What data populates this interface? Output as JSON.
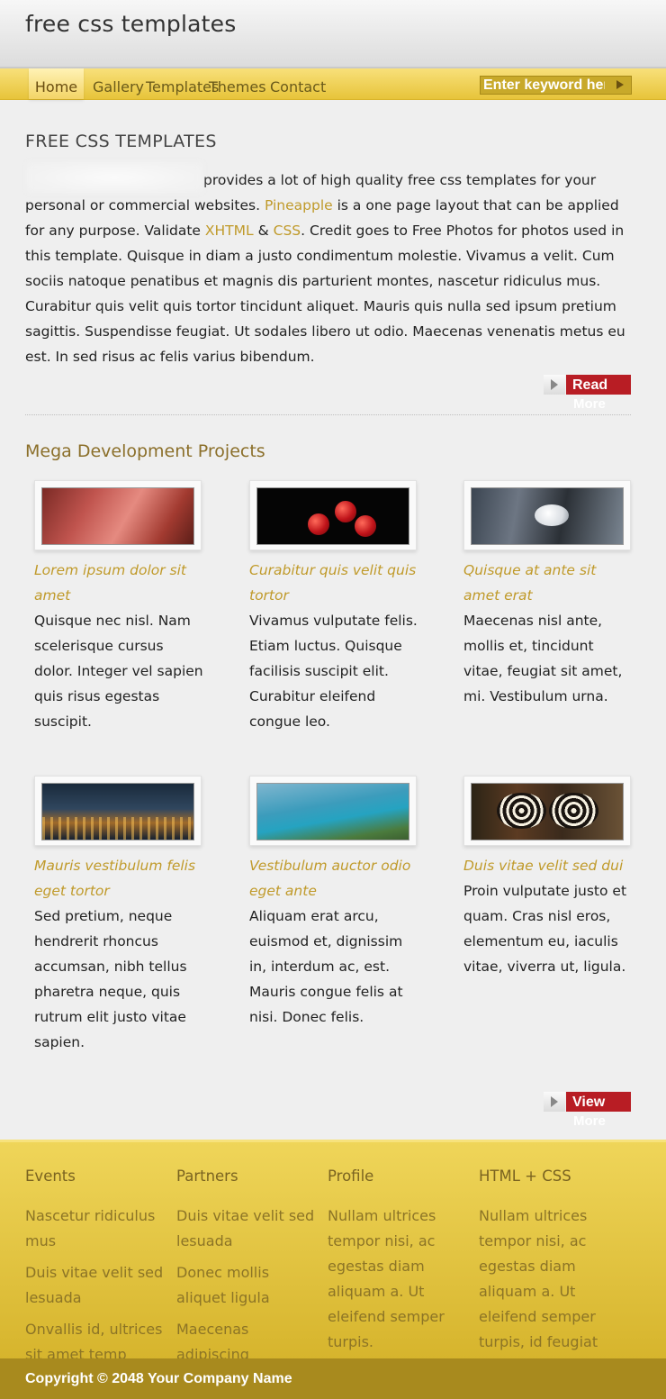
{
  "site": {
    "title": "free css templates"
  },
  "nav": {
    "items": [
      "Home",
      "Gallery",
      "Templates",
      "Themes",
      "Contact"
    ],
    "search_placeholder": "Enter keyword here",
    "accent": "#e9c83e"
  },
  "intro": {
    "title": "FREE CSS TEMPLATES",
    "text_1": "provides a lot of high quality free css templates for your personal or commercial websites.",
    "link_pineapple": "Pineapple",
    "text_2": "is a one page layout that can be applied for any purpose. Validate",
    "link_xhtml": "XHTML",
    "text_amp": "&",
    "link_css": "CSS",
    "text_3": ". Credit goes to Free Photos for photos used in this template. Quisque in diam a justo condimentum molestie. Vivamus a velit. Cum sociis natoque penatibus et magnis dis parturient montes, nascetur ridiculus mus. Curabitur quis velit quis tortor tincidunt aliquet. Mauris quis nulla sed ipsum pretium sagittis. Suspendisse feugiat. Ut sodales libero ut odio. Maecenas venenatis metus eu est. In sed risus ac felis varius bibendum.",
    "read_more_top": "Read",
    "read_more_bottom": "More"
  },
  "projects": {
    "title": "Mega Development Projects",
    "items": [
      {
        "title": "Lorem ipsum dolor sit amet",
        "text": "Quisque nec nisl. Nam scelerisque cursus dolor. Integer vel sapien quis risus egestas suscipit.",
        "image": "interior-photo"
      },
      {
        "title": "Curabitur quis velit quis tortor",
        "text": "Vivamus vulputate felis. Etiam luctus. Quisque facilisis suscipit elit. Curabitur eleifend congue leo.",
        "image": "apples-photo"
      },
      {
        "title": "Quisque at ante sit amet erat",
        "text": "Maecenas nisl ante, mollis et, tincidunt vitae, feugiat sit amet, mi. Vestibulum urna.",
        "image": "stone-photo"
      },
      {
        "title": "Mauris vestibulum felis eget tortor",
        "text": "Sed pretium, neque hendrerit rhoncus accumsan, nibh tellus pharetra neque, quis rutrum elit justo vitae sapien.",
        "image": "city-night-photo"
      },
      {
        "title": "Vestibulum auctor odio eget ante",
        "text": "Aliquam erat arcu, euismod et, dignissim in, interdum ac, est. Mauris congue felis at nisi. Donec felis.",
        "image": "coastline-photo"
      },
      {
        "title": "Duis vitae velit sed dui",
        "text": "Proin vulputate justo et quam. Cras nisl eros, elementum eu, iaculis vitae, viverra ut, ligula.",
        "image": "butterfly-photo"
      }
    ],
    "view_more_top": "View",
    "view_more_bottom": "More"
  },
  "footer": {
    "columns": [
      {
        "title": "Events",
        "links": [
          "Nascetur ridiculus mus",
          "Duis vitae velit sed lesuada",
          "Onvallis id, ultrices sit amet temp"
        ]
      },
      {
        "title": "Partners",
        "links": [
          "Duis vitae velit sed lesuada",
          "Donec mollis aliquet ligula",
          "Maecenas adipiscing"
        ]
      },
      {
        "title": "Profile",
        "links": [
          "Nullam ultrices tempor nisi, ac egestas diam aliquam a. Ut eleifend semper turpis."
        ]
      },
      {
        "title": "HTML + CSS",
        "links": [
          "Nullam ultrices tempor nisi, ac egestas diam aliquam a. Ut eleifend semper turpis, id feugiat"
        ]
      }
    ],
    "copyright": "Copyright © 2048 Your Company Name",
    "bg_color": "#e0c03e",
    "bar_color": "#a88a1e"
  }
}
